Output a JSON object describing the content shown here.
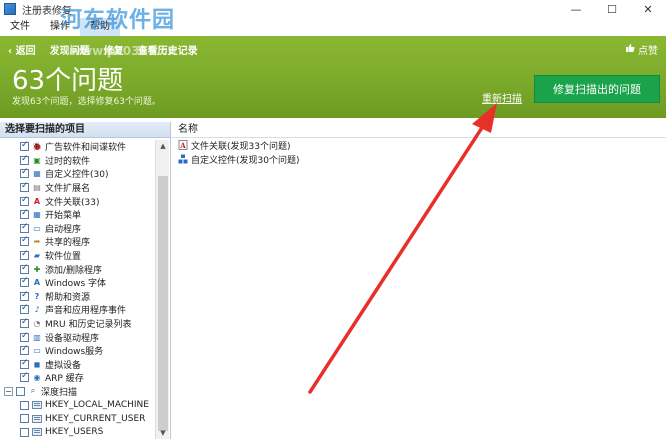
{
  "window": {
    "title": "注册表修复",
    "watermark": "河东软件园",
    "watermark_url": "www.pc0359.cn",
    "controls": {
      "minimize": "—",
      "maximize": "☐",
      "close": "✕"
    }
  },
  "menu": {
    "items": [
      {
        "label": "文件"
      },
      {
        "label": "操作"
      },
      {
        "label": "帮助"
      }
    ]
  },
  "header": {
    "nav": [
      {
        "label": "‹ 返回"
      },
      {
        "label": "发现问题"
      },
      {
        "label": "修复"
      },
      {
        "label": "查看历史记录"
      }
    ],
    "like_label": "点赞",
    "count_title": "63个问题",
    "subtitle": "发现63个问题，选择修复63个问题。",
    "rescan_label": "重新扫描",
    "fix_button_label": "修复扫描出的问题"
  },
  "left_panel": {
    "title": "选择要扫描的项目",
    "items": [
      {
        "label": "广告软件和间谍软件",
        "icon": "adware-icon",
        "checked": true
      },
      {
        "label": "过时的软件",
        "icon": "trash-icon",
        "checked": true
      },
      {
        "label": "自定义控件(30)",
        "icon": "controls-icon",
        "checked": true
      },
      {
        "label": "文件扩展名",
        "icon": "document-icon",
        "checked": true
      },
      {
        "label": "文件关联(33)",
        "icon": "file-assoc-icon",
        "checked": true
      },
      {
        "label": "开始菜单",
        "icon": "start-menu-icon",
        "checked": true
      },
      {
        "label": "启动程序",
        "icon": "startup-icon",
        "checked": true
      },
      {
        "label": "共享的程序",
        "icon": "shared-icon",
        "checked": true
      },
      {
        "label": "软件位置",
        "icon": "location-icon",
        "checked": true
      },
      {
        "label": "添加/删除程序",
        "icon": "add-remove-icon",
        "checked": true
      },
      {
        "label": "Windows 字体",
        "icon": "font-icon",
        "checked": true
      },
      {
        "label": "帮助和资源",
        "icon": "help-icon",
        "checked": true
      },
      {
        "label": "声音和应用程序事件",
        "icon": "sound-icon",
        "checked": true
      },
      {
        "label": "MRU 和历史记录列表",
        "icon": "history-icon",
        "checked": true
      },
      {
        "label": "设备驱动程序",
        "icon": "driver-icon",
        "checked": true
      },
      {
        "label": "Windows服务",
        "icon": "service-icon",
        "checked": true
      },
      {
        "label": "虚拟设备",
        "icon": "virtual-icon",
        "checked": true
      },
      {
        "label": "ARP 缓存",
        "icon": "arp-icon",
        "checked": true
      }
    ],
    "deep_scan": {
      "label": "深度扫描",
      "items": [
        {
          "label": "HKEY_LOCAL_MACHINE"
        },
        {
          "label": "HKEY_CURRENT_USER"
        },
        {
          "label": "HKEY_USERS"
        }
      ]
    }
  },
  "right_panel": {
    "column_header": "名称",
    "rows": [
      {
        "label": "文件关联(发现33个问题)",
        "icon": "file-assoc-icon"
      },
      {
        "label": "自定义控件(发现30个问题)",
        "icon": "controls-icon"
      }
    ]
  },
  "colors": {
    "header_green": "#7aa82a",
    "fix_button": "#1aa34a",
    "arrow": "#e8302a"
  }
}
